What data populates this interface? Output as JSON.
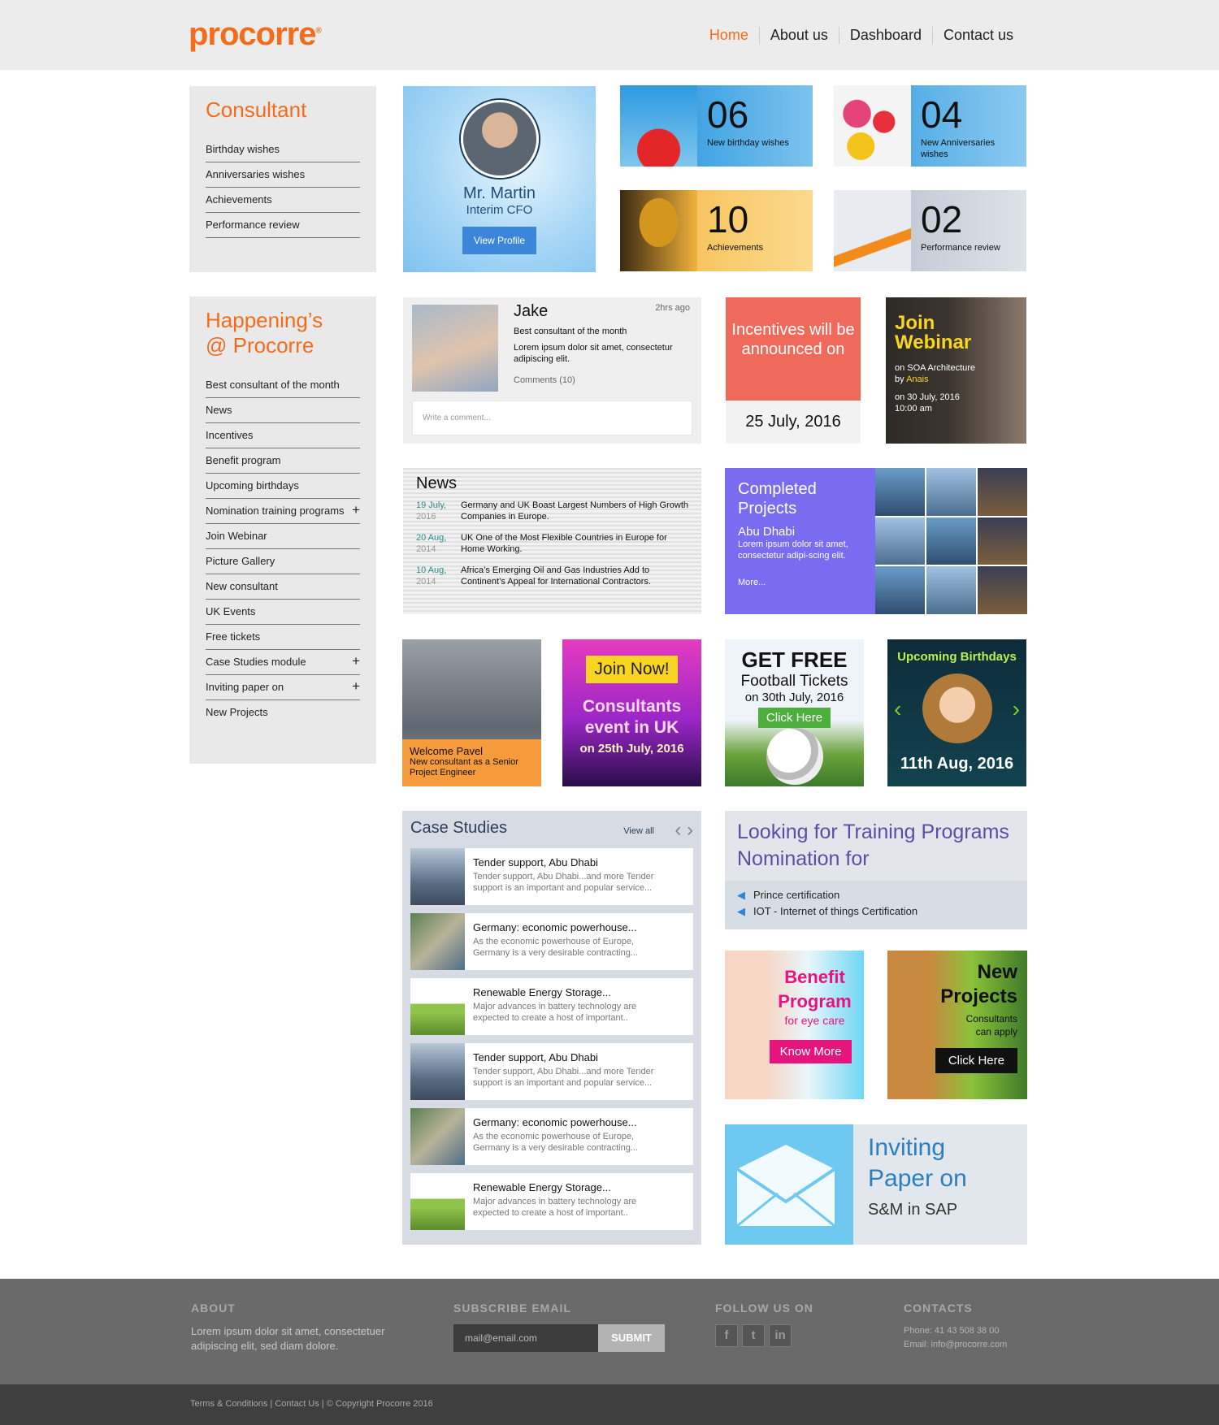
{
  "header": {
    "logo": "procorre",
    "nav": [
      "Home",
      "About us",
      "Dashboard",
      "Contact us"
    ]
  },
  "consultant": {
    "title": "Consultant",
    "items": [
      "Birthday wishes",
      "Anniversaries wishes",
      "Achievements",
      "Performance review"
    ]
  },
  "profile": {
    "name": "Mr. Martin",
    "role": "Interim CFO",
    "button": "View Profile"
  },
  "stats": [
    {
      "num": "06",
      "label": "New birthday wishes"
    },
    {
      "num": "04",
      "label": "New Anniversaries wishes"
    },
    {
      "num": "10",
      "label": "Achievements"
    },
    {
      "num": "02",
      "label": "Performance review"
    }
  ],
  "happenings": {
    "title_1": "Happening’s",
    "title_2": "@ Procorre",
    "items": [
      {
        "label": "Best consultant of the month",
        "plus": ""
      },
      {
        "label": "News",
        "plus": ""
      },
      {
        "label": "Incentives",
        "plus": ""
      },
      {
        "label": "Benefit program",
        "plus": ""
      },
      {
        "label": "Upcoming birthdays",
        "plus": ""
      },
      {
        "label": "Nomination training programs",
        "plus": "+"
      },
      {
        "label": "Join Webinar",
        "plus": ""
      },
      {
        "label": "Picture Gallery",
        "plus": ""
      },
      {
        "label": "New consultant",
        "plus": ""
      },
      {
        "label": "UK Events",
        "plus": ""
      },
      {
        "label": "Free tickets",
        "plus": ""
      },
      {
        "label": "Case Studies module",
        "plus": "+"
      },
      {
        "label": "Inviting paper on",
        "plus": "+"
      },
      {
        "label": "New Projects",
        "plus": ""
      }
    ]
  },
  "post": {
    "name": "Jake",
    "time": "2hrs ago",
    "title": "Best consultant of the month",
    "body": "Lorem ipsum dolor sit amet, consectetur adipiscing elit.",
    "comments": "Comments (10)",
    "placeholder": "Write a comment..."
  },
  "incentives": {
    "text": "Incentives will be announced on",
    "date": "25 July, 2016"
  },
  "webinar": {
    "title_1": "Join",
    "title_2": "Webinar",
    "topic": "on SOA Architecture",
    "by": "by",
    "speaker": "Anais",
    "date": "on 30 July, 2016",
    "time": "10:00 am"
  },
  "news": {
    "title": "News",
    "items": [
      {
        "day": "19 July,",
        "year": "2016",
        "text": "Germany and UK Boast Largest Numbers of High Growth Companies in Europe."
      },
      {
        "day": "20 Aug,",
        "year": "2014",
        "text": "UK One of the Most Flexible Countries in Europe for Home Working."
      },
      {
        "day": "10 Aug,",
        "year": "2014",
        "text": "Africa’s Emerging Oil and Gas Industries Add to Continent’s Appeal for International Contractors."
      }
    ]
  },
  "completed": {
    "title_1": "Completed",
    "title_2": "Projects",
    "city": "Abu Dhabi",
    "body": "Lorem ipsum dolor sit amet, consectetur adipi-scing elit.",
    "more": "More..."
  },
  "pavel": {
    "title": "Welcome Pavel",
    "body": "New consultant as a Senior Project Engineer"
  },
  "uk_event": {
    "button": "Join Now!",
    "title_1": "Consultants",
    "title_2": "event in UK",
    "date": "on 25th July, 2016"
  },
  "free_tickets": {
    "title": "GET FREE",
    "sub": "Football Tickets",
    "date": "on 30th July, 2016",
    "button": "Click Here"
  },
  "birthdays": {
    "title": "Upcoming Birthdays",
    "date": "11th Aug, 2016"
  },
  "case_studies": {
    "title": "Case Studies",
    "view_all": "View all",
    "items": [
      {
        "title": "Tender support, Abu Dhabi",
        "body": "Tender support, Abu Dhabi...and more Tender support is an important and popular service...",
        "thumb": "city"
      },
      {
        "title": "Germany: economic powerhouse...",
        "body": "As the economic powerhouse of Europe, Germany is a very desirable contracting...",
        "thumb": "aerial"
      },
      {
        "title": "Renewable Energy Storage...",
        "body": "Major advances in battery technology are expected to create a host of important..",
        "thumb": "energy"
      },
      {
        "title": "Tender support, Abu Dhabi",
        "body": "Tender support, Abu Dhabi...and more Tender support is an important and popular service...",
        "thumb": "city"
      },
      {
        "title": "Germany: economic powerhouse...",
        "body": "As the economic powerhouse of Europe, Germany is a very desirable contracting...",
        "thumb": "aerial"
      },
      {
        "title": "Renewable Energy Storage...",
        "body": "Major advances in battery technology are expected to create a host of important..",
        "thumb": "energy"
      }
    ]
  },
  "training": {
    "title_1": "Looking for Training Programs",
    "title_2": "Nomination for",
    "items": [
      "Prince certification",
      "IOT - Internet of things Certification"
    ]
  },
  "benefit": {
    "title_1": "Benefit",
    "title_2": "Program",
    "sub": "for eye care",
    "button": "Know More"
  },
  "new_projects": {
    "title_1": "New",
    "title_2": "Projects",
    "sub_1": "Consultants",
    "sub_2": "can apply",
    "button": "Click Here"
  },
  "inviting": {
    "title_1": "Inviting",
    "title_2": "Paper on",
    "sub": "S&M in SAP"
  },
  "footer": {
    "about_title": "ABOUT",
    "about_text": "Lorem ipsum dolor sit amet, consectetuer adipiscing elit, sed diam dolore.",
    "subscribe_title": "SUBSCRIBE EMAIL",
    "email_placeholder": "mail@email.com",
    "submit": "SUBMIT",
    "follow_title": "FOLLOW US ON",
    "social": [
      "f",
      "t",
      "in"
    ],
    "contacts_title": "CONTACTS",
    "phone": "Phone: 41 43 508 38 00",
    "email": "Email:  info@procorre.com"
  },
  "copyright": "Terms & Conditions | Contact Us | © Copyright Procorre 2016",
  "colors": {
    "brand": "#f26c1c",
    "purple": "#7a6cf0",
    "coral": "#f06a5c",
    "pink": "#e6157d"
  }
}
